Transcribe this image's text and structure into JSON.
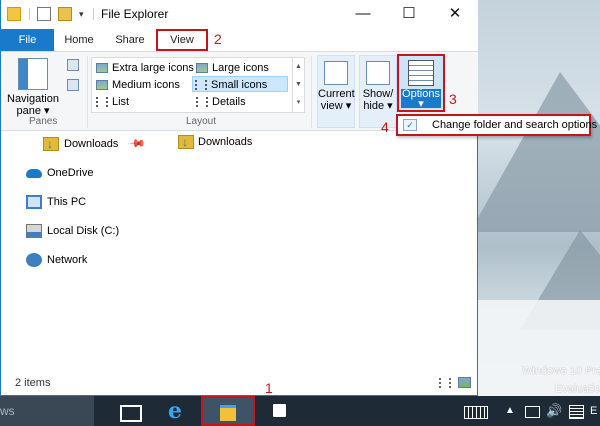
{
  "window": {
    "title": "File Explorer",
    "minimize_glyph": "—",
    "maximize_glyph": "☐",
    "close_glyph": "✕"
  },
  "tabs": [
    {
      "label": "File"
    },
    {
      "label": "Home"
    },
    {
      "label": "Share"
    },
    {
      "label": "View"
    }
  ],
  "help_glyph": "?",
  "pin_glyph": "↔",
  "ribbon": {
    "panes": {
      "nav_label": "Navigation pane",
      "group_label": "Panes"
    },
    "layout": {
      "group_label": "Layout",
      "options": [
        {
          "label": "Extra large icons"
        },
        {
          "label": "Large icons"
        },
        {
          "label": "Medium icons"
        },
        {
          "label": "Small icons",
          "selected": true
        },
        {
          "label": "List"
        },
        {
          "label": "Details"
        }
      ]
    },
    "current_view": {
      "label": "Current view"
    },
    "show_hide": {
      "label": "Show/ hide"
    },
    "options": {
      "label": "Options"
    }
  },
  "options_menu": {
    "item_label": "Change folder and search options"
  },
  "callouts": {
    "c1": "1",
    "c2": "2",
    "c3": "3",
    "c4": "4"
  },
  "nav_pane": {
    "items": [
      {
        "label": "Downloads",
        "icon": "downloads-icon",
        "pinned": true
      },
      {
        "label": "OneDrive",
        "icon": "onedrive-icon"
      },
      {
        "label": "This PC",
        "icon": "this-pc-icon"
      },
      {
        "label": "Local Disk (C:)",
        "icon": "local-disk-icon"
      },
      {
        "label": "Network",
        "icon": "network-icon"
      }
    ]
  },
  "content": {
    "items": [
      {
        "label": "Downloads",
        "icon": "downloads-icon"
      }
    ]
  },
  "status": {
    "item_count": "2 items"
  },
  "desktop": {
    "watermark_line1": "Windows 10 Pro",
    "watermark_line2": "Evaluation"
  },
  "taskbar": {
    "search_text": "ws",
    "ie_glyph": "e",
    "tray_up_glyph": "▲",
    "volume_glyph": "🔊",
    "language": "E"
  },
  "colors": {
    "accent": "#1979ca",
    "highlight_red": "#c3161c",
    "taskbar": "#1e2a36"
  }
}
